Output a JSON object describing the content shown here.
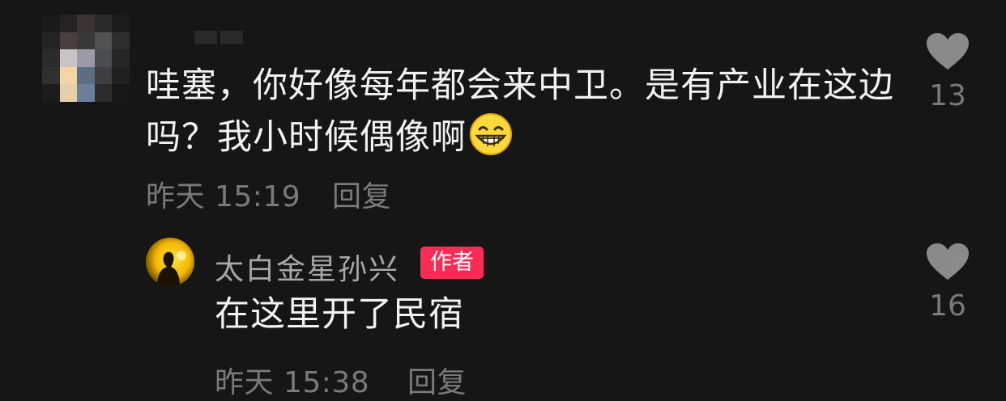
{
  "comment": {
    "text": "哇塞，你好像每年都会来中卫。是有产业在这边吗？我小时候偶像啊",
    "emoji": "grinning-face-emoji",
    "date": "昨天",
    "time": "15:19",
    "reply_label": "回复",
    "like_count": "13"
  },
  "reply": {
    "username": "太白金星孙兴",
    "badge": "作者",
    "text": "在这里开了民宿",
    "date": "昨天",
    "time": "15:38",
    "reply_label": "回复",
    "like_count": "16"
  },
  "colors": {
    "background": "#161616",
    "text": "#f2f2f2",
    "muted": "#7a7a7a",
    "username": "#a8a8a8",
    "badge": "#fe2c55",
    "heart": "#8a8a8a"
  }
}
